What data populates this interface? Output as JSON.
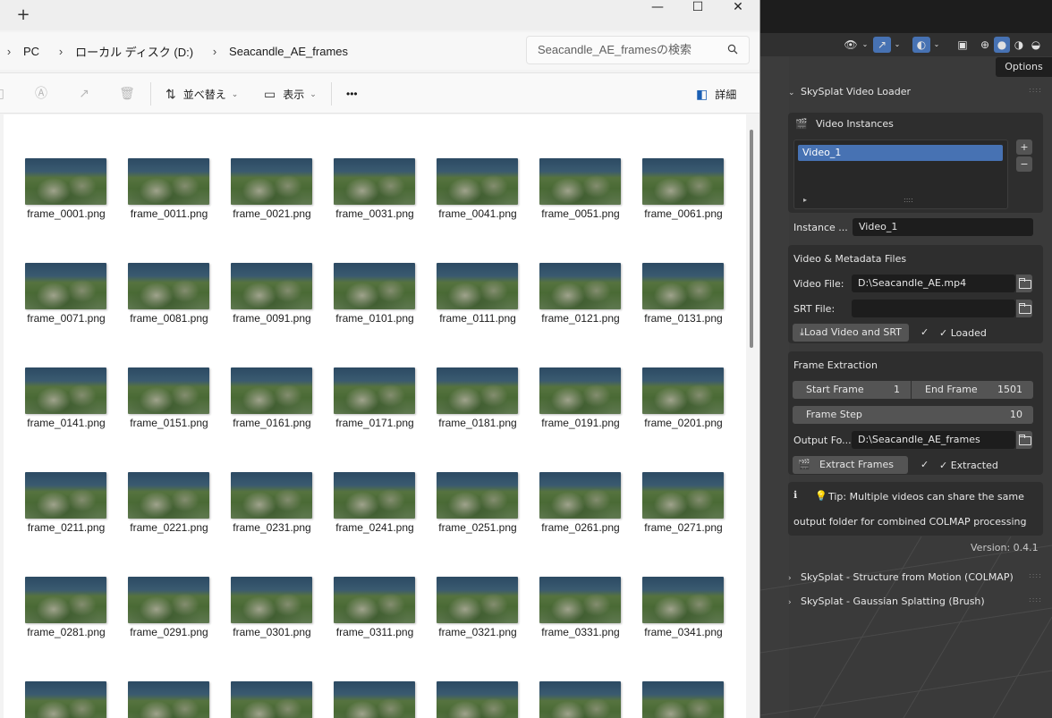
{
  "explorer": {
    "new_tab": "+",
    "window_buttons": {
      "minimize": "—",
      "maximize": "☐",
      "close": "✕"
    },
    "breadcrumbs": [
      "PC",
      "ローカル ディスク (D:)",
      "Seacandle_AE_frames"
    ],
    "search_placeholder": "Seacandle_AE_framesの検索",
    "toolbar": {
      "sort_label": "並べ替え",
      "view_label": "表示",
      "more_label": "•••",
      "details_label": "詳細"
    },
    "files": [
      "frame_0001.png",
      "frame_0011.png",
      "frame_0021.png",
      "frame_0031.png",
      "frame_0041.png",
      "frame_0051.png",
      "frame_0061.png",
      "frame_0071.png",
      "frame_0081.png",
      "frame_0091.png",
      "frame_0101.png",
      "frame_0111.png",
      "frame_0121.png",
      "frame_0131.png",
      "frame_0141.png",
      "frame_0151.png",
      "frame_0161.png",
      "frame_0171.png",
      "frame_0181.png",
      "frame_0191.png",
      "frame_0201.png",
      "frame_0211.png",
      "frame_0221.png",
      "frame_0231.png",
      "frame_0241.png",
      "frame_0251.png",
      "frame_0261.png",
      "frame_0271.png",
      "frame_0281.png",
      "frame_0291.png",
      "frame_0301.png",
      "frame_0311.png",
      "frame_0321.png",
      "frame_0331.png",
      "frame_0341.png",
      "",
      "",
      "",
      "",
      "",
      "",
      ""
    ]
  },
  "blender": {
    "options_tab": "Options",
    "panel_title": "SkySplat Video Loader",
    "video_instances": {
      "title": "Video Instances",
      "items": [
        "Video_1"
      ],
      "add": "+",
      "remove": "−"
    },
    "instance_label": "Instance ...",
    "instance_value": "Video_1",
    "files_section": {
      "title": "Video & Metadata Files",
      "video_label": "Video File:",
      "video_value": "D:\\Seacandle_AE.mp4",
      "srt_label": "SRT File:",
      "srt_value": "",
      "load_button": "Load Video and SRT",
      "loaded_status": "✓ Loaded"
    },
    "extraction": {
      "title": "Frame Extraction",
      "start_label": "Start Frame",
      "start_value": "1",
      "end_label": "End Frame",
      "end_value": "1501",
      "step_label": "Frame Step",
      "step_value": "10",
      "output_label": "Output Fo...",
      "output_value": "D:\\Seacandle_AE_frames",
      "extract_button": "Extract Frames",
      "extracted_status": "✓ Extracted"
    },
    "tip": {
      "line1": "Tip: Multiple videos can share the same",
      "line2": "output folder for combined COLMAP processing"
    },
    "version": "Version: 0.4.1",
    "collapsed_panels": [
      "SkySplat - Structure from Motion (COLMAP)",
      "SkySplat - Gaussian Splatting (Brush)"
    ]
  }
}
